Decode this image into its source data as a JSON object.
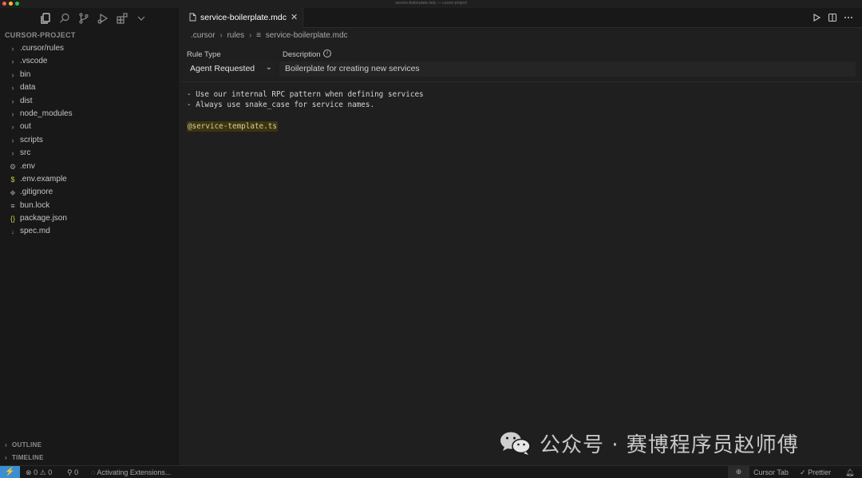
{
  "window": {
    "title": "service-boilerplate.mdc — cursor-project",
    "traffic_colors": [
      "#ff5f57",
      "#febc2e",
      "#28c840"
    ]
  },
  "activity_bar": {
    "icons": [
      "files-icon",
      "search-icon",
      "source-control-icon",
      "run-debug-icon",
      "extensions-icon",
      "chevron-down-icon"
    ]
  },
  "explorer": {
    "title": "CURSOR-PROJECT",
    "items": [
      {
        "label": ".cursor/rules",
        "kind": "folder",
        "icon": "chevron-right"
      },
      {
        "label": ".vscode",
        "kind": "folder",
        "icon": "chevron-right"
      },
      {
        "label": "bin",
        "kind": "folder",
        "icon": "chevron-right"
      },
      {
        "label": "data",
        "kind": "folder",
        "icon": "chevron-right"
      },
      {
        "label": "dist",
        "kind": "folder",
        "icon": "chevron-right"
      },
      {
        "label": "node_modules",
        "kind": "folder",
        "icon": "chevron-right"
      },
      {
        "label": "out",
        "kind": "folder",
        "icon": "chevron-right"
      },
      {
        "label": "scripts",
        "kind": "folder",
        "icon": "chevron-right"
      },
      {
        "label": "src",
        "kind": "folder",
        "icon": "chevron-right"
      },
      {
        "label": ".env",
        "kind": "file",
        "icon": "gear",
        "color": "#a0a0a0"
      },
      {
        "label": ".env.example",
        "kind": "file",
        "icon": "$",
        "color": "#cbcb41"
      },
      {
        "label": ".gitignore",
        "kind": "file",
        "icon": "◆",
        "color": "#6a6a6a"
      },
      {
        "label": "bun.lock",
        "kind": "file",
        "icon": "≡",
        "color": "#b0b0b0"
      },
      {
        "label": "package.json",
        "kind": "file",
        "icon": "{}",
        "color": "#cbcb41"
      },
      {
        "label": "spec.md",
        "kind": "file",
        "icon": "↓",
        "color": "#519aba"
      }
    ],
    "outline_label": "OUTLINE",
    "timeline_label": "TIMELINE"
  },
  "tab": {
    "label": "service-boilerplate.mdc",
    "close": "✕"
  },
  "breadcrumb": {
    "parts": [
      ".cursor",
      "rules",
      "service-boilerplate.mdc"
    ]
  },
  "rule_form": {
    "rule_type_label": "Rule Type",
    "rule_type_value": "Agent Requested",
    "description_label": "Description",
    "description_value": "Boilerplate for creating new services"
  },
  "code": {
    "lines": [
      "- Use our internal RPC pattern when defining services",
      "- Always use snake_case for service names.",
      "",
      "@service-template.ts"
    ]
  },
  "watermark": {
    "text": "公众号 · 赛博程序员赵师傅"
  },
  "statusbar": {
    "errors": "0",
    "warnings": "0",
    "ports": "0",
    "activity": "Activating Extensions...",
    "cursor_tab": "Cursor Tab",
    "prettier": "Prettier",
    "remote_color": "#3b8fd0"
  }
}
